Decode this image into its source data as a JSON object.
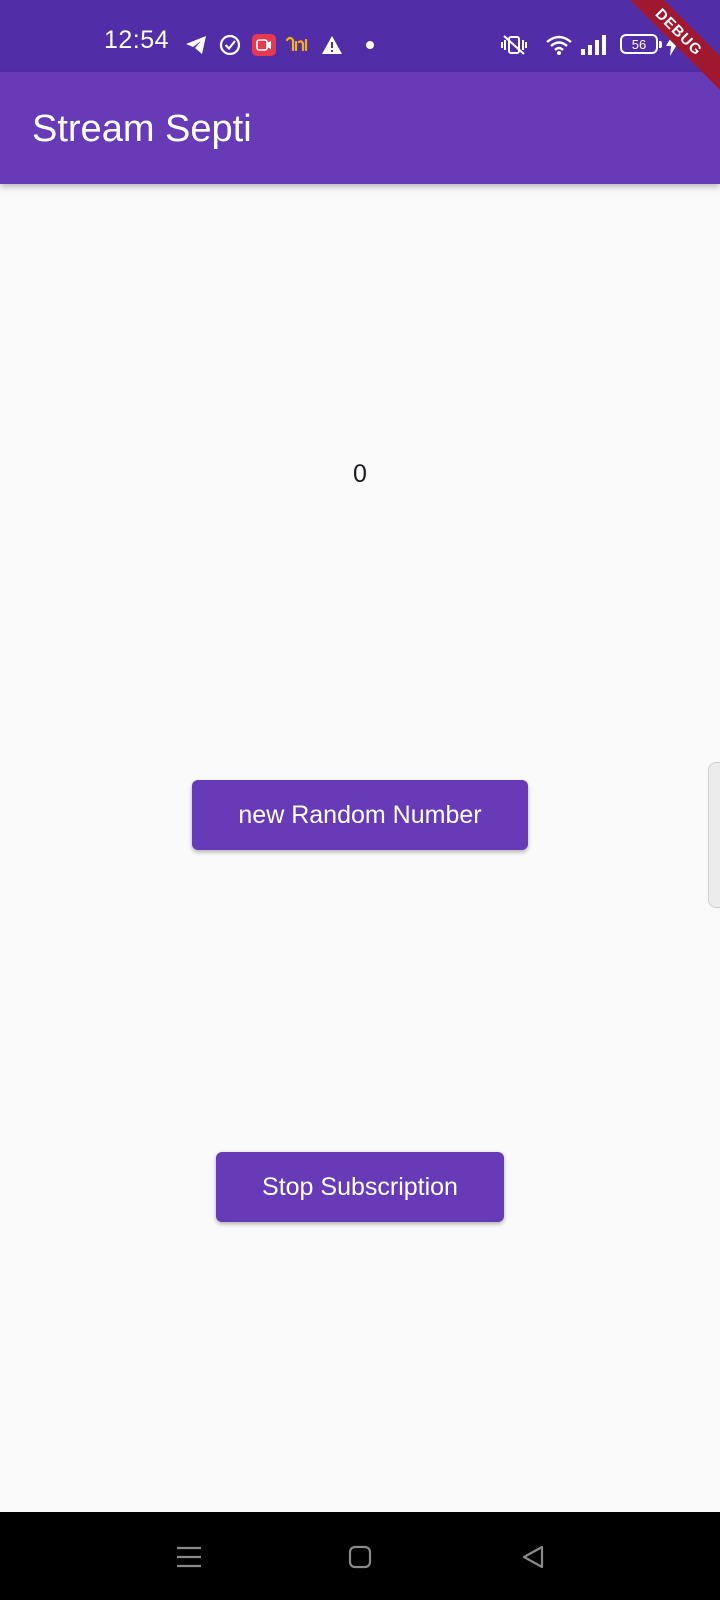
{
  "status_bar": {
    "time": "12:54",
    "battery": "56",
    "icons": [
      "telegram-icon",
      "check-circle-icon",
      "screen-record-icon",
      "liyin-app-icon",
      "warning-icon",
      "dot-icon",
      "vibrate-icon",
      "wifi-icon",
      "signal-icon",
      "battery-icon",
      "charging-icon"
    ]
  },
  "debug_banner": {
    "label": "DEBUG"
  },
  "app_bar": {
    "title": "Stream Septi"
  },
  "main": {
    "counter_value": "0",
    "new_random_button": "new Random Number",
    "stop_button": "Stop Subscription"
  },
  "nav_bar": {
    "icons": [
      "menu-icon",
      "home-icon",
      "back-icon"
    ]
  },
  "colors": {
    "primary": "#673ab7",
    "status_bar": "#512da8",
    "background": "#fafafa",
    "debug_banner": "#a01830"
  }
}
